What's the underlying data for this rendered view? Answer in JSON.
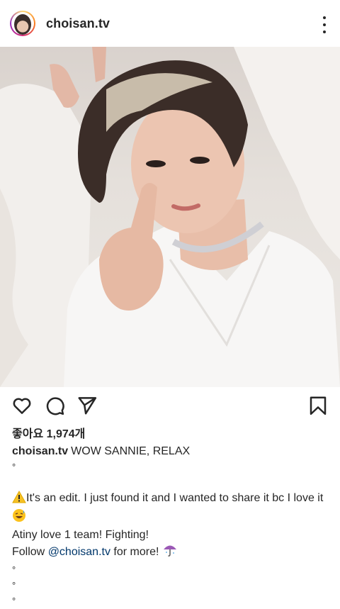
{
  "post": {
    "username": "choisan.tv",
    "likes_text": "좋아요 1,974개",
    "caption": {
      "username": "choisan.tv",
      "text": "WOW SANNIE, RELAX",
      "dot": "°",
      "line1": "It's an edit. I just found it and I wanted to share it bc I love it",
      "line2": "Atiny love 1 team! Fighting!",
      "line3_prefix": "Follow ",
      "mention": "@choisan.tv",
      "line3_suffix": " for more! "
    }
  },
  "icons": {
    "avatar": "profile-avatar",
    "more": "more-options-icon",
    "like": "heart-icon",
    "comment": "comment-icon",
    "share": "paper-plane-icon",
    "save": "bookmark-icon",
    "warning": "warning-emoji",
    "laugh": "grinning-sweat-emoji",
    "umbrella": "umbrella-emoji"
  },
  "colors": {
    "text": "#262626",
    "mention": "#00376b"
  }
}
